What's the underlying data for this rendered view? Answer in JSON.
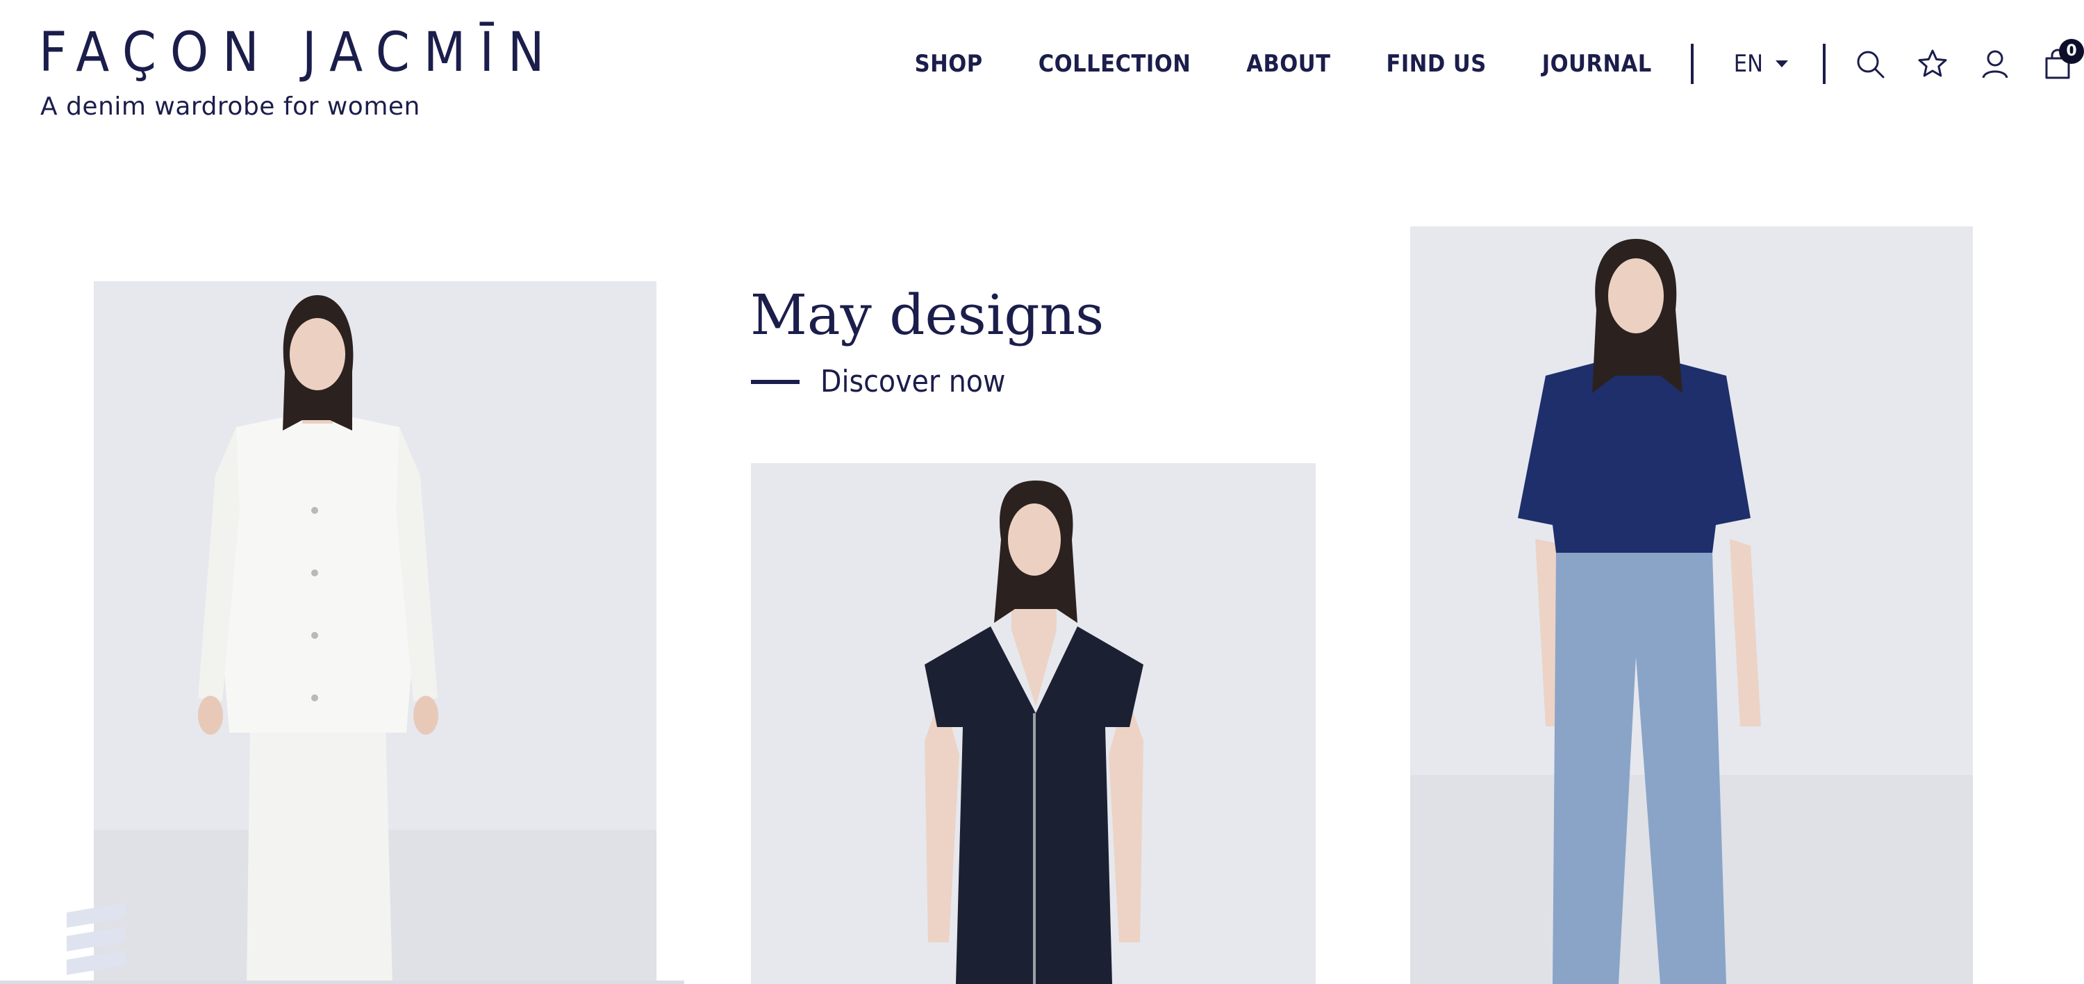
{
  "brand": {
    "name": "FAÇON JACMĪN",
    "tagline": "A denim wardrobe for women"
  },
  "nav": {
    "links": [
      "SHOP",
      "COLLECTION",
      "ABOUT",
      "FIND US",
      "JOURNAL"
    ],
    "language": "EN",
    "icons": [
      "search-icon",
      "star-icon",
      "user-icon",
      "shopping-bag-icon"
    ],
    "cart_count": "0"
  },
  "promo": {
    "title": "May designs",
    "cta": "Discover now"
  },
  "colors": {
    "navy": "#1b1d4b",
    "photo_background": "#e6e8ee"
  },
  "images": [
    {
      "name": "model-white-denim-shirt-and-trousers"
    },
    {
      "name": "model-dark-denim-zip-dress"
    },
    {
      "name": "model-navy-polo-and-light-blue-jeans"
    }
  ]
}
